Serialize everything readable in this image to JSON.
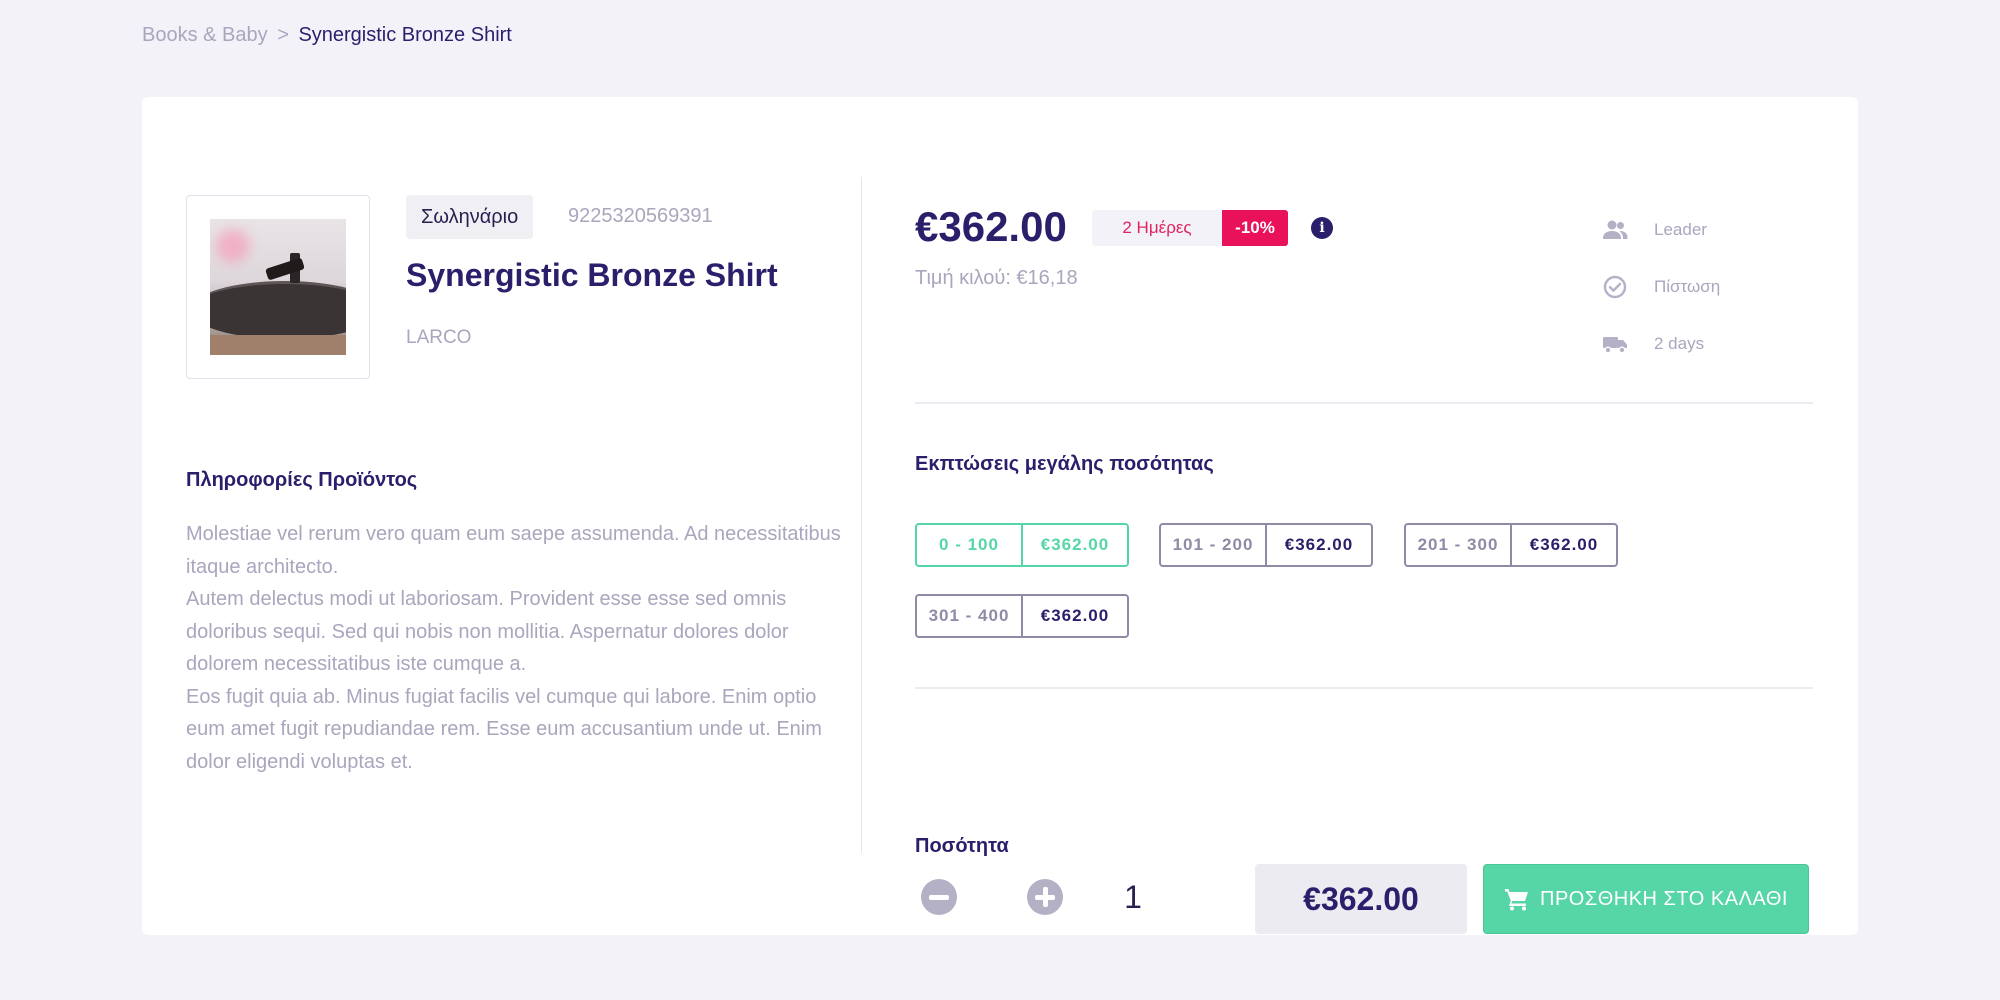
{
  "breadcrumb": {
    "parent": "Books & Baby",
    "separator": ">",
    "current": "Synergistic Bronze Shirt"
  },
  "product": {
    "category_badge": "Σωληνάριο",
    "sku": "9225320569391",
    "title": "Synergistic Bronze Shirt",
    "brand": "LARCO",
    "info_heading": "Πληροφορίες Προϊόντος",
    "description": [
      "Molestiae vel rerum vero quam eum saepe assumenda. Ad necessitatibus itaque architecto.",
      "Autem delectus modi ut laboriosam. Provident esse esse sed omnis doloribus sequi. Sed qui nobis non mollitia. Aspernatur dolores dolor dolorem necessitatibus iste cumque a.",
      "Eos fugit quia ab. Minus fugiat facilis vel cumque qui labore. Enim optio eum amet fugit repudiandae rem. Esse eum accusantium unde ut. Enim dolor eligendi voluptas et."
    ]
  },
  "pricing": {
    "price": "€362.00",
    "delivery_badge": "2 Ημέρες",
    "discount_badge": "-10%",
    "unit_price": "Τιμή κιλού: €16,18"
  },
  "features": [
    {
      "icon": "users-icon",
      "label": "Leader"
    },
    {
      "icon": "check-circle-icon",
      "label": "Πίστωση"
    },
    {
      "icon": "truck-icon",
      "label": "2 days"
    }
  ],
  "bulk": {
    "heading": "Εκπτώσεις μεγάλης ποσότητας",
    "tiers": [
      {
        "range": "0 - 100",
        "price": "€362.00",
        "active": true
      },
      {
        "range": "101 - 200",
        "price": "€362.00",
        "active": false
      },
      {
        "range": "201 - 300",
        "price": "€362.00",
        "active": false
      },
      {
        "range": "301 - 400",
        "price": "€362.00",
        "active": false
      }
    ]
  },
  "quantity": {
    "label": "Ποσότητα",
    "value": "1",
    "total": "€362.00",
    "add_to_cart": "ΠΡΟΣΘΗΚΗ ΣΤΟ ΚΑΛΑΘΙ"
  },
  "colors": {
    "background": "#f3f2f8",
    "primary_text": "#2a1f6b",
    "muted_text": "#a9a6bd",
    "accent_green": "#56d6a6",
    "discount_pink": "#e8115a"
  }
}
